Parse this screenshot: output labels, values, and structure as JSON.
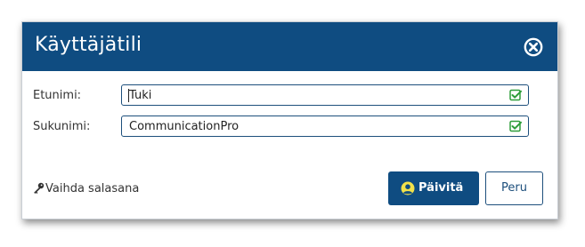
{
  "dialog": {
    "title": "Käyttäjätili",
    "close_icon": "close-circle-icon"
  },
  "form": {
    "first_name": {
      "label": "Etunimi:",
      "value": "Tuki",
      "status_icon": "checkbox-checked-icon"
    },
    "last_name": {
      "label": "Sukunimi:",
      "value": "CommunicationPro",
      "status_icon": "checkbox-checked-icon"
    }
  },
  "actions": {
    "change_password": "Vaihda salasana",
    "change_password_icon": "key-icon",
    "update": "Päivitä",
    "update_icon": "user-circle-icon",
    "cancel": "Peru"
  },
  "colors": {
    "header": "#0f4c81",
    "check": "#2e9d3a",
    "update_icon": "#f2e14a"
  }
}
